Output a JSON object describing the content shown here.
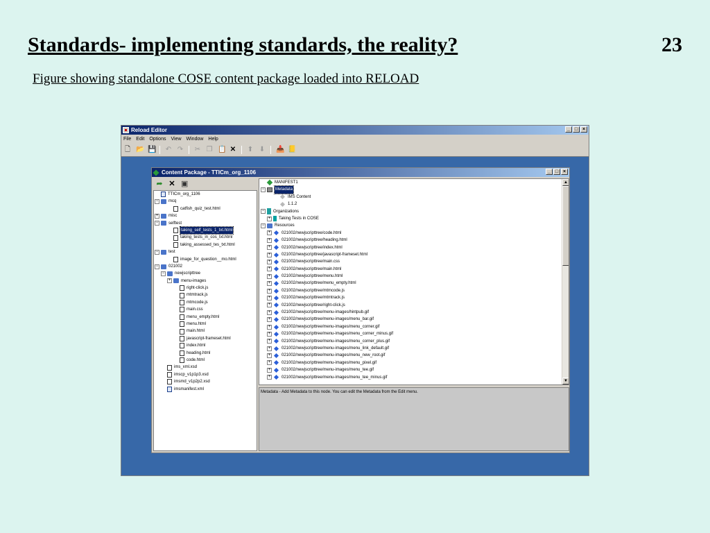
{
  "slide": {
    "title": "Standards- implementing standards, the reality?",
    "number": "23",
    "subtitle": "Figure showing standalone COSE content package loaded into RELOAD"
  },
  "app": {
    "title": "Reload Editor",
    "window_buttons": [
      "_",
      "□",
      "×"
    ],
    "menu": [
      "File",
      "Edit",
      "Options",
      "View",
      "Window",
      "Help"
    ],
    "toolbar_icons": [
      "new-icon",
      "open-icon",
      "save-icon",
      "undo-icon",
      "redo-icon",
      "cut-icon",
      "copy-icon",
      "paste-icon",
      "delete-icon",
      "move-up-icon",
      "move-down-icon",
      "import-icon",
      "notes-icon"
    ]
  },
  "content_window": {
    "title": "Content Package - TTICm_org_1106",
    "window_buttons": [
      "_",
      "□",
      "×"
    ],
    "left_toolbar_icons": [
      "open-folder-icon",
      "delete-icon",
      "refresh-icon"
    ],
    "status_text": "Metadata - Add Metadata to this node.  You can edit the Metadata from the Edit menu."
  },
  "left_tree": [
    {
      "depth": 0,
      "icon": "xml",
      "exp": "",
      "label": "TTICm_org_1106"
    },
    {
      "depth": 0,
      "icon": "folder",
      "exp": "−",
      "label": "mcq"
    },
    {
      "depth": 2,
      "icon": "file",
      "exp": "",
      "label": "catfish_quiz_test.html"
    },
    {
      "depth": 0,
      "icon": "folder",
      "exp": "+",
      "label": "misc"
    },
    {
      "depth": 0,
      "icon": "folder",
      "exp": "−",
      "label": "selftest"
    },
    {
      "depth": 2,
      "icon": "file",
      "exp": "",
      "label": "taking_self_tests_1_txt.html",
      "selected": true
    },
    {
      "depth": 2,
      "icon": "file",
      "exp": "",
      "label": "taking_tests_in_cos_txt.html"
    },
    {
      "depth": 2,
      "icon": "file",
      "exp": "",
      "label": "taking_assessed_tes_txt.html"
    },
    {
      "depth": 0,
      "icon": "folder",
      "exp": "−",
      "label": "test"
    },
    {
      "depth": 2,
      "icon": "file",
      "exp": "",
      "label": "image_for_question__mo.html"
    },
    {
      "depth": 0,
      "icon": "folder",
      "exp": "−",
      "label": "021002"
    },
    {
      "depth": 1,
      "icon": "folder",
      "exp": "−",
      "label": "newjscripttree"
    },
    {
      "depth": 2,
      "icon": "folder",
      "exp": "+",
      "label": "menu-images"
    },
    {
      "depth": 3,
      "icon": "file",
      "exp": "",
      "label": "right-click.js"
    },
    {
      "depth": 3,
      "icon": "file",
      "exp": "",
      "label": "mtmtrack.js"
    },
    {
      "depth": 3,
      "icon": "file",
      "exp": "",
      "label": "mtmcode.js"
    },
    {
      "depth": 3,
      "icon": "file",
      "exp": "",
      "label": "main.css"
    },
    {
      "depth": 3,
      "icon": "file",
      "exp": "",
      "label": "menu_empty.html"
    },
    {
      "depth": 3,
      "icon": "file",
      "exp": "",
      "label": "menu.html"
    },
    {
      "depth": 3,
      "icon": "file",
      "exp": "",
      "label": "main.html"
    },
    {
      "depth": 3,
      "icon": "file",
      "exp": "",
      "label": "javascript-frameset.html"
    },
    {
      "depth": 3,
      "icon": "file",
      "exp": "",
      "label": "index.html"
    },
    {
      "depth": 3,
      "icon": "file",
      "exp": "",
      "label": "heading.html"
    },
    {
      "depth": 3,
      "icon": "file",
      "exp": "",
      "label": "code.html"
    },
    {
      "depth": 1,
      "icon": "file",
      "exp": "",
      "label": "ims_xml.xsd"
    },
    {
      "depth": 1,
      "icon": "file",
      "exp": "",
      "label": "imscp_v1p1p3.xsd"
    },
    {
      "depth": 1,
      "icon": "file",
      "exp": "",
      "label": "imsmd_v1p2p2.xsd"
    },
    {
      "depth": 1,
      "icon": "xml",
      "exp": "",
      "label": "imsmanifest.xml"
    }
  ],
  "right_tree": [
    {
      "depth": 0,
      "icon": "pkg",
      "exp": "",
      "label": "MANIFEST1"
    },
    {
      "depth": 0,
      "icon": "meta",
      "exp": "−",
      "label": "Metadata",
      "selected": true
    },
    {
      "depth": 2,
      "icon": "diamond grey",
      "exp": "",
      "label": "IMS Content"
    },
    {
      "depth": 2,
      "icon": "diamond grey",
      "exp": "",
      "label": "1.1.2"
    },
    {
      "depth": 0,
      "icon": "org",
      "exp": "−",
      "label": "Organizations"
    },
    {
      "depth": 1,
      "icon": "item",
      "exp": "+",
      "label": "Taking Tests in COSE"
    },
    {
      "depth": 0,
      "icon": "folder",
      "exp": "−",
      "label": "Resources"
    },
    {
      "depth": 1,
      "icon": "diamond",
      "exp": "+",
      "label": "021002/newjscripttree/code.html"
    },
    {
      "depth": 1,
      "icon": "diamond",
      "exp": "+",
      "label": "021002/newjscripttree/heading.html"
    },
    {
      "depth": 1,
      "icon": "diamond",
      "exp": "+",
      "label": "021002/newjscripttree/index.html"
    },
    {
      "depth": 1,
      "icon": "diamond",
      "exp": "+",
      "label": "021002/newjscripttree/javascript-frameset.html"
    },
    {
      "depth": 1,
      "icon": "diamond",
      "exp": "+",
      "label": "021002/newjscripttree/main.css"
    },
    {
      "depth": 1,
      "icon": "diamond",
      "exp": "+",
      "label": "021002/newjscripttree/main.html"
    },
    {
      "depth": 1,
      "icon": "diamond",
      "exp": "+",
      "label": "021002/newjscripttree/menu.html"
    },
    {
      "depth": 1,
      "icon": "diamond",
      "exp": "+",
      "label": "021002/newjscripttree/menu_empty.html"
    },
    {
      "depth": 1,
      "icon": "diamond",
      "exp": "+",
      "label": "021002/newjscripttree/mtmcode.js"
    },
    {
      "depth": 1,
      "icon": "diamond",
      "exp": "+",
      "label": "021002/newjscripttree/mtmtrack.js"
    },
    {
      "depth": 1,
      "icon": "diamond",
      "exp": "+",
      "label": "021002/newjscripttree/right-click.js"
    },
    {
      "depth": 1,
      "icon": "diamond",
      "exp": "+",
      "label": "021002/newjscripttree/menu-images/hintpub.gif"
    },
    {
      "depth": 1,
      "icon": "diamond",
      "exp": "+",
      "label": "021002/newjscripttree/menu-images/menu_bar.gif"
    },
    {
      "depth": 1,
      "icon": "diamond",
      "exp": "+",
      "label": "021002/newjscripttree/menu-images/menu_corner.gif"
    },
    {
      "depth": 1,
      "icon": "diamond",
      "exp": "+",
      "label": "021002/newjscripttree/menu-images/menu_corner_minus.gif"
    },
    {
      "depth": 1,
      "icon": "diamond",
      "exp": "+",
      "label": "021002/newjscripttree/menu-images/menu_corner_plus.gif"
    },
    {
      "depth": 1,
      "icon": "diamond",
      "exp": "+",
      "label": "021002/newjscripttree/menu-images/menu_link_default.gif"
    },
    {
      "depth": 1,
      "icon": "diamond",
      "exp": "+",
      "label": "021002/newjscripttree/menu-images/menu_new_root.gif"
    },
    {
      "depth": 1,
      "icon": "diamond",
      "exp": "+",
      "label": "021002/newjscripttree/menu-images/menu_pixel.gif"
    },
    {
      "depth": 1,
      "icon": "diamond",
      "exp": "+",
      "label": "021002/newjscripttree/menu-images/menu_tee.gif"
    },
    {
      "depth": 1,
      "icon": "diamond",
      "exp": "+",
      "label": "021002/newjscripttree/menu-images/menu_tee_minus.gif"
    }
  ]
}
